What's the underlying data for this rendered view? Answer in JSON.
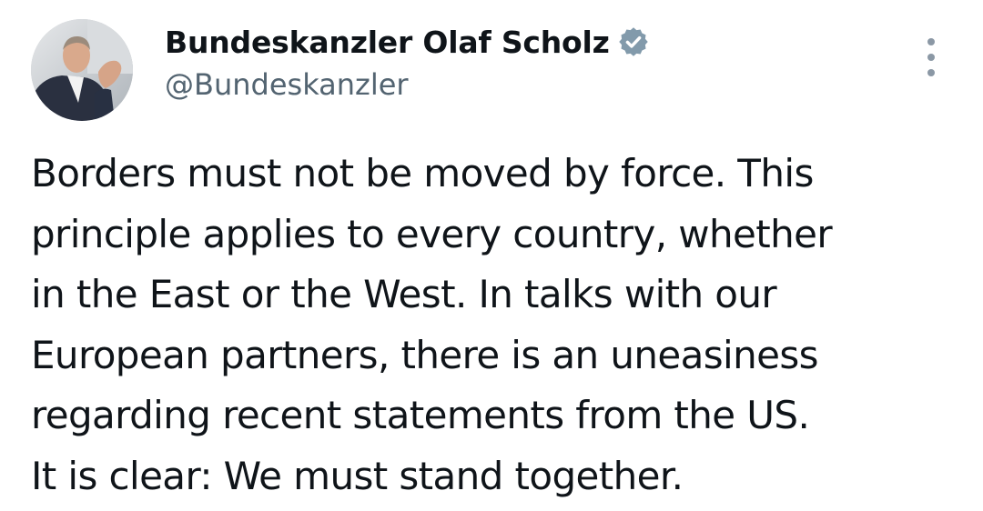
{
  "tweet": {
    "author": {
      "display_name": "Bundeskanzler Olaf Scholz",
      "handle": "@Bundeskanzler",
      "avatar_icon": "profile-photo",
      "verified_icon": "verified-badge-icon"
    },
    "more_icon": "more-options-icon",
    "text_lines": [
      "Borders must not be moved by force. This",
      "principle applies to every country, whether",
      "in the East or the West. In talks with our",
      "European partners, there is an uneasiness",
      "regarding recent statements from the US.",
      "It is clear: We must stand together."
    ]
  },
  "colors": {
    "text_primary": "#0f1419",
    "text_secondary": "#536471",
    "verified_badge": "#829aab"
  }
}
